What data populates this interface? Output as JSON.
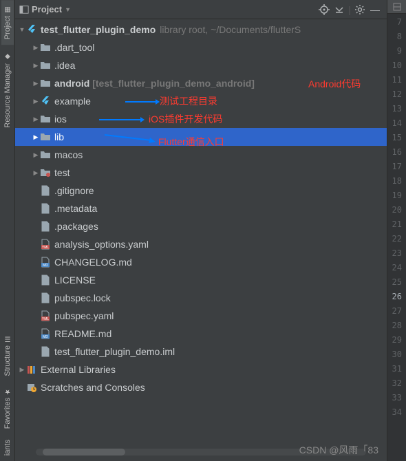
{
  "header": {
    "dropdown_label": "Project"
  },
  "rail": {
    "project": "Project",
    "resource_mgr": "Resource Manager",
    "structure": "Structure",
    "favorites": "Favorites",
    "variants": "iants"
  },
  "tree": {
    "root": {
      "label": "test_flutter_plugin_demo",
      "suffix": "library root,  ~/Documents/flutterS"
    },
    "items": [
      {
        "label": ".dart_tool",
        "type": "folder",
        "expandable": true
      },
      {
        "label": ".idea",
        "type": "folder",
        "expandable": true
      },
      {
        "label": "android",
        "type": "folder",
        "expandable": true,
        "bracket": "[test_flutter_plugin_demo_android]"
      },
      {
        "label": "example",
        "type": "flutter",
        "expandable": true
      },
      {
        "label": "ios",
        "type": "folder",
        "expandable": true
      },
      {
        "label": "lib",
        "type": "folder",
        "expandable": true,
        "selected": true
      },
      {
        "label": "macos",
        "type": "folder",
        "expandable": true
      },
      {
        "label": "test",
        "type": "folder-dot",
        "expandable": true
      },
      {
        "label": ".gitignore",
        "type": "file"
      },
      {
        "label": ".metadata",
        "type": "file"
      },
      {
        "label": ".packages",
        "type": "file"
      },
      {
        "label": "analysis_options.yaml",
        "type": "yaml"
      },
      {
        "label": "CHANGELOG.md",
        "type": "md"
      },
      {
        "label": "LICENSE",
        "type": "file"
      },
      {
        "label": "pubspec.lock",
        "type": "file"
      },
      {
        "label": "pubspec.yaml",
        "type": "yaml"
      },
      {
        "label": "README.md",
        "type": "md"
      },
      {
        "label": "test_flutter_plugin_demo.iml",
        "type": "file"
      }
    ],
    "external": "External Libraries",
    "scratches": "Scratches and Consoles"
  },
  "annotations": {
    "android": "Android代码",
    "example": "测试工程目录",
    "ios": "iOS插件开发代码",
    "lib": "Flutter通信入口"
  },
  "gutter": {
    "start": 7,
    "end": 34,
    "highlight": 26
  },
  "watermark": "CSDN @风雨「83"
}
